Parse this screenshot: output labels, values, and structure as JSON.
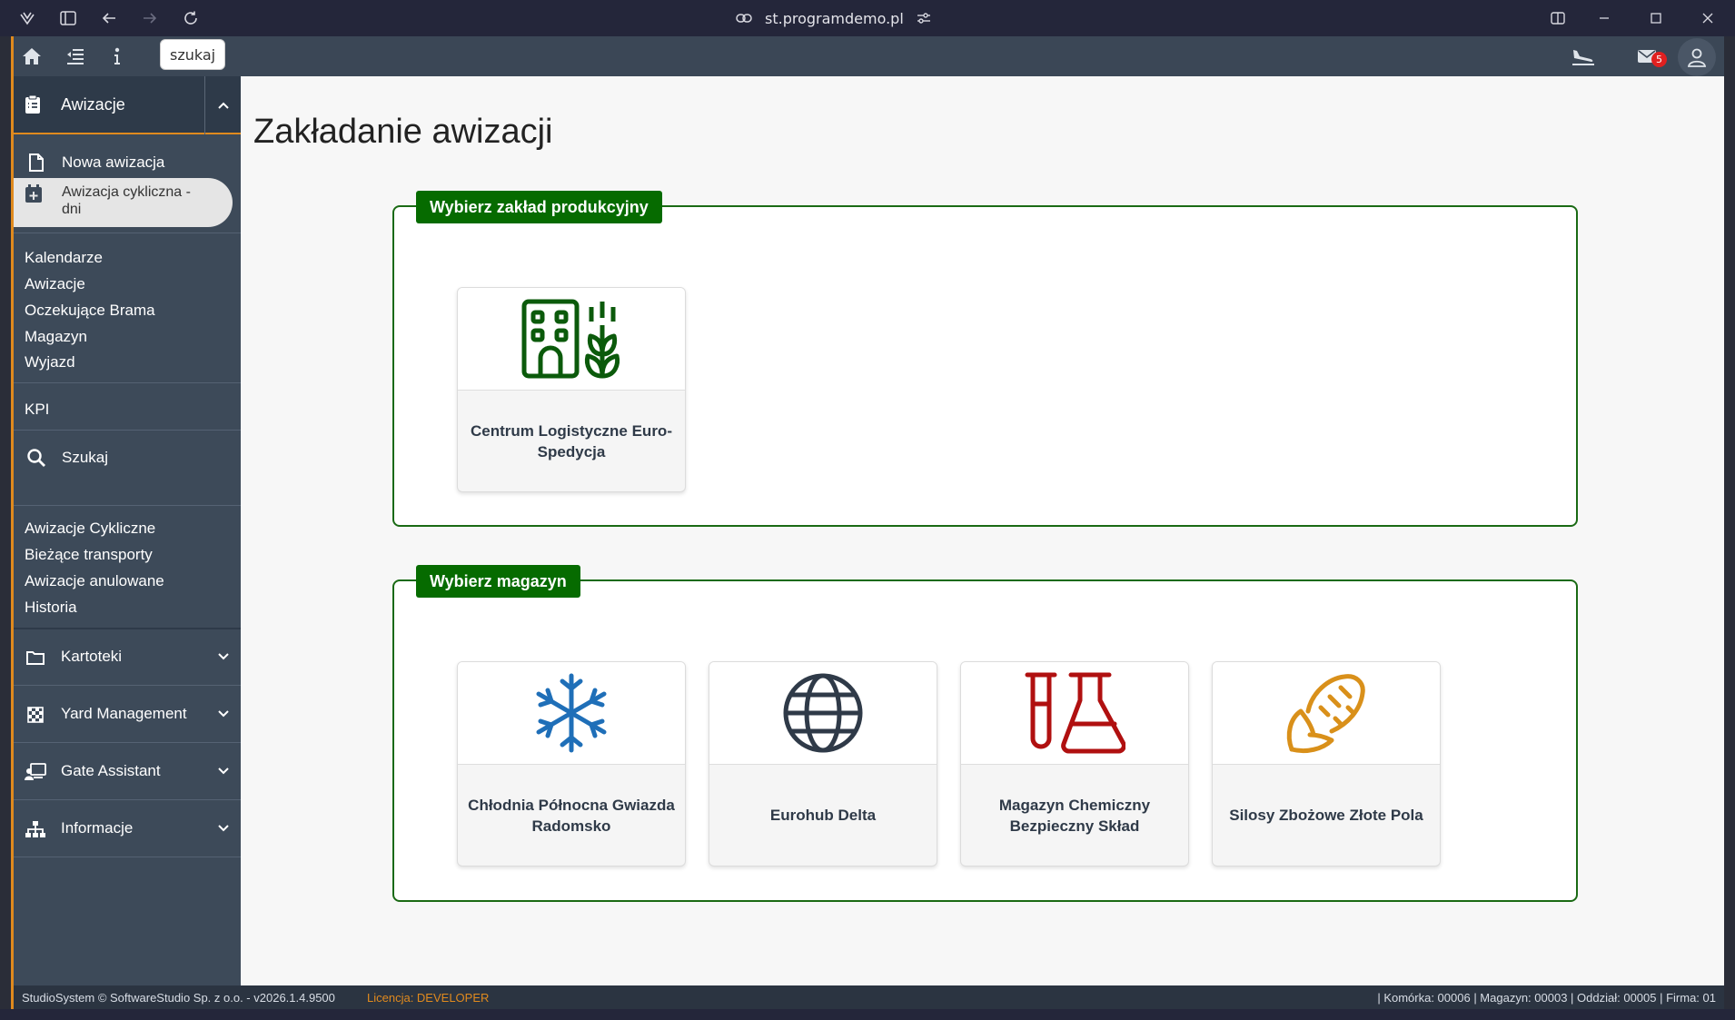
{
  "browser": {
    "url": "st.programdemo.pl"
  },
  "appbar": {
    "search_chip": "szukaj",
    "mail_badge": "5"
  },
  "sidebar": {
    "header_label": "Awizacje",
    "active_items": [
      {
        "label": "Nowa awizacja",
        "icon": "file-icon"
      },
      {
        "label": "Awizacja cykliczna -\ndni",
        "icon": "calendar-plus-icon"
      }
    ],
    "links_group_1": [
      "Kalendarze",
      "Awizacje",
      "Oczekujące Brama",
      "Magazyn",
      "Wyjazd"
    ],
    "kpi": "KPI",
    "search_label": "Szukaj",
    "links_group_2": [
      "Awizacje Cykliczne",
      "Bieżące transporty",
      "Awizacje anulowane",
      "Historia"
    ],
    "groups": [
      {
        "label": "Kartoteki",
        "icon": "folder-icon"
      },
      {
        "label": "Yard Management",
        "icon": "checker-icon"
      },
      {
        "label": "Gate Assistant",
        "icon": "desk-user-icon"
      },
      {
        "label": "Informacje",
        "icon": "sitemap-icon"
      }
    ]
  },
  "main": {
    "title": "Zakładanie awizacji",
    "section_plant": {
      "label": "Wybierz zakład produkcyjny",
      "cards": [
        {
          "name": "Centrum Logistyczne Euro-Spedycja",
          "icon": "building-wheat-icon",
          "color": "#0b5a0b"
        }
      ]
    },
    "section_warehouse": {
      "label": "Wybierz magazyn",
      "cards": [
        {
          "name": "Chłodnia Północna Gwiazda Radomsko",
          "icon": "snowflake-icon",
          "color": "#1f6fb8"
        },
        {
          "name": "Eurohub Delta",
          "icon": "globe-icon",
          "color": "#2f3a48"
        },
        {
          "name": "Magazyn Chemiczny Bezpieczny Skład",
          "icon": "flask-vial-icon",
          "color": "#b01010"
        },
        {
          "name": "Silosy Zbożowe Złote Pola",
          "icon": "corn-icon",
          "color": "#d9901a"
        }
      ]
    }
  },
  "footer": {
    "copyright": "StudioSystem © SoftwareStudio Sp. z o.o. - v2026.1.4.9500",
    "license_prefix": "Licencja: ",
    "license_value": "DEVELOPER",
    "context": "| Komórka: 00006 | Magazyn: 00003 | Oddział: 00005 | Firma: 01"
  }
}
